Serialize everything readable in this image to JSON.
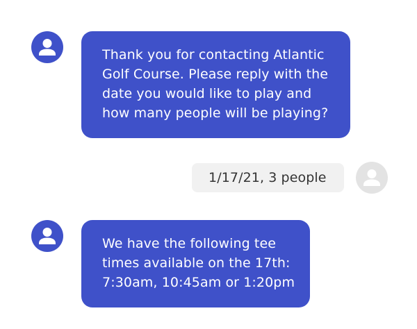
{
  "colors": {
    "agent_bubble": "#3f51c9",
    "agent_text": "#ffffff",
    "user_bubble": "#f1f1f1",
    "user_text": "#333333",
    "user_avatar": "#e3e3e3"
  },
  "messages": [
    {
      "sender": "agent",
      "avatar_icon": "person-icon",
      "lines": [
        "Thank you for contacting Atlantic",
        "Golf Course. Please reply with the",
        "date you would like to play and",
        "how many people will be playing?"
      ]
    },
    {
      "sender": "user",
      "avatar_icon": "person-icon",
      "lines": [
        "1/17/21, 3 people"
      ]
    },
    {
      "sender": "agent",
      "avatar_icon": "person-icon",
      "lines": [
        "We have the following tee",
        "times available on the 17th:",
        "7:30am, 10:45am or 1:20pm"
      ]
    }
  ]
}
